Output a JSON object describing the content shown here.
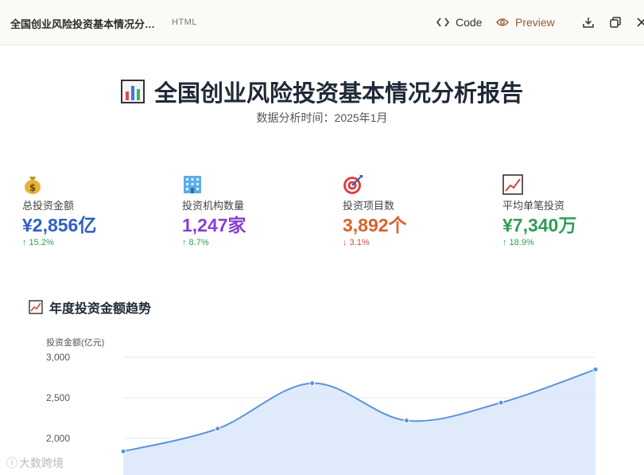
{
  "topbar": {
    "doc_title": "全国创业风险投资基本情况分…",
    "doc_type": "HTML",
    "code_label": "Code",
    "preview_label": "Preview"
  },
  "header": {
    "title": "全国创业风险投资基本情况分析报告",
    "subtitle": "数据分析时间：2025年1月"
  },
  "stats": [
    {
      "label": "总投资金额",
      "value": "¥2,856亿",
      "change": "↑ 15.2%",
      "color": "#2f5fc4",
      "icon": "money-bag-icon"
    },
    {
      "label": "投资机构数量",
      "value": "1,247家",
      "change": "↑ 8.7%",
      "color": "#8a3fd1",
      "icon": "office-building-icon"
    },
    {
      "label": "投资项目数",
      "value": "3,892个",
      "change": "↓ 3.1%",
      "color": "#d9622b",
      "icon": "target-icon"
    },
    {
      "label": "平均单笔投资",
      "value": "¥7,340万",
      "change": "↑ 18.9%",
      "color": "#2e9e56",
      "icon": "chart-increasing-icon"
    }
  ],
  "chart": {
    "title": "年度投资金额趋势"
  },
  "chart_data": {
    "type": "area",
    "ylabel": "投资金额(亿元)",
    "y_ticks": [
      "3,000",
      "2,500",
      "2,000"
    ],
    "ylim": [
      1850,
      3000
    ],
    "values": [
      1840,
      2120,
      2680,
      2220,
      2440,
      2850
    ],
    "line_color": "#5b93dd",
    "fill_color": "#dbe8fb"
  },
  "watermark": "大数跨境"
}
